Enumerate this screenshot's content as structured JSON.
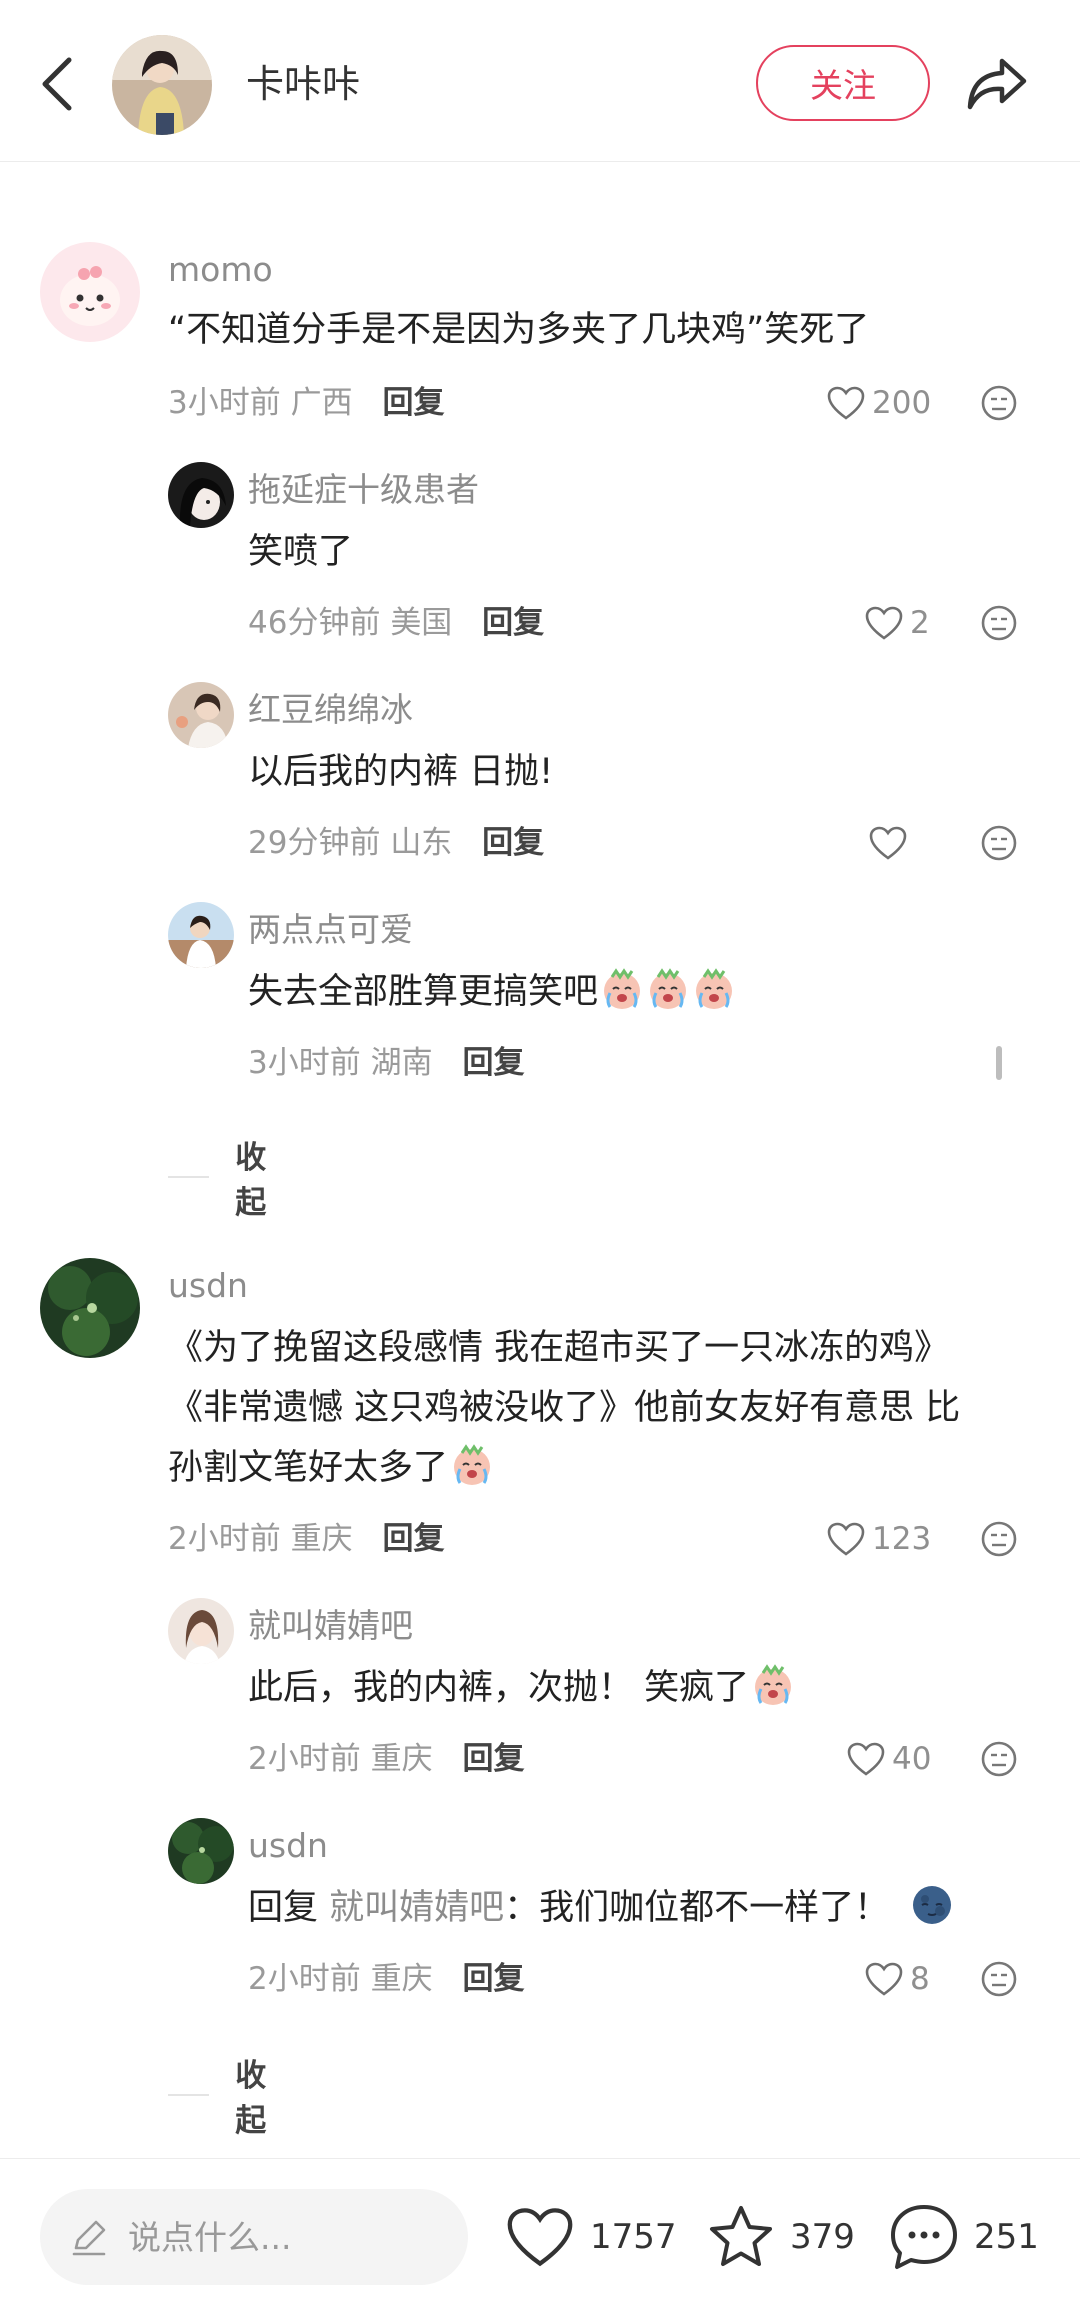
{
  "header": {
    "author_name": "卡咔咔",
    "follow_label": "关注"
  },
  "comments": [
    {
      "user": "momo",
      "text": "“不知道分手是不是因为多夹了几块鸡”笑死了",
      "time": "3小时前",
      "location": "广西",
      "reply_label": "回复",
      "likes": "200",
      "replies": [
        {
          "user": "拖延症十级患者",
          "text": "笑喷了",
          "time": "46分钟前",
          "location": "美国",
          "reply_label": "回复",
          "likes": "2"
        },
        {
          "user": "红豆绵绵冰",
          "text": "以后我的内裤 日抛!",
          "time": "29分钟前",
          "location": "山东",
          "reply_label": "回复",
          "likes": ""
        },
        {
          "user": "两点点可爱",
          "text": "失去全部胜算更搞笑吧",
          "time": "3小时前",
          "location": "湖南",
          "reply_label": "回复",
          "likes": ""
        }
      ],
      "collapse_label": "收起"
    },
    {
      "user": "usdn",
      "text_lines": [
        "《为了挽留这段感情 我在超市买了一只冰冻的鸡》",
        "《非常遗憾 这只鸡被没收了》他前女友好有意思 比",
        "孙割文笔好太多了"
      ],
      "time": "2小时前",
      "location": "重庆",
      "reply_label": "回复",
      "likes": "123",
      "replies": [
        {
          "user": "就叫婧婧吧",
          "text": "此后，我的内裤，次抛！ 笑疯了",
          "time": "2小时前",
          "location": "重庆",
          "reply_label": "回复",
          "likes": "40"
        },
        {
          "user": "usdn",
          "reply_prefix": "回复",
          "mention": "就叫婧婧吧",
          "text": "：我们咖位都不一样了！",
          "time": "2小时前",
          "location": "重庆",
          "reply_label": "回复",
          "likes": "8"
        }
      ],
      "collapse_label": "收起"
    }
  ],
  "bottom_bar": {
    "input_placeholder": "说点什么...",
    "likes_count": "1757",
    "favorites_count": "379",
    "comments_count": "251"
  },
  "colors": {
    "accent": "#e4415e",
    "meta_gray": "#9a9a9a",
    "name_gray": "#8c8c8c"
  }
}
